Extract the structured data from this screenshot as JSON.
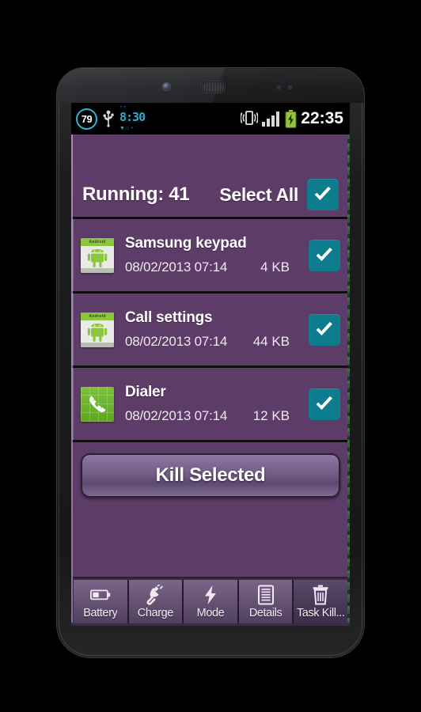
{
  "status_bar": {
    "battery_percent": "79",
    "usb_icon": "usb-icon",
    "clock_widget": {
      "time": "8:30",
      "top_marks": "°°",
      "bottom_marks": "▼○◔"
    },
    "vibrate_icon": "vibrate-icon",
    "signal_icon": "signal-bars-icon",
    "battery_icon": "battery-charging-icon",
    "time": "22:35"
  },
  "header": {
    "running_label": "Running: 41",
    "select_all_label": "Select All",
    "select_all_checked": true
  },
  "list": {
    "rows": [
      {
        "icon": "android-app-icon",
        "icon_badge": "Android",
        "name": "Samsung keypad",
        "date": "08/02/2013 07:14",
        "size": "4 KB",
        "checked": true
      },
      {
        "icon": "android-app-icon",
        "icon_badge": "Android",
        "name": "Call settings",
        "date": "08/02/2013 07:14",
        "size": "44 KB",
        "checked": true
      },
      {
        "icon": "dialer-phone-icon",
        "icon_badge": "",
        "name": "Dialer",
        "date": "08/02/2013 07:14",
        "size": "12 KB",
        "checked": true
      }
    ]
  },
  "action": {
    "kill_label": "Kill Selected"
  },
  "tabbar": {
    "tabs": [
      {
        "label": "Battery",
        "icon": "battery-icon",
        "selected": false
      },
      {
        "label": "Charge",
        "icon": "plug-icon",
        "selected": false
      },
      {
        "label": "Mode",
        "icon": "lightning-icon",
        "selected": false
      },
      {
        "label": "Details",
        "icon": "document-icon",
        "selected": false
      },
      {
        "label": "Task Kill...",
        "icon": "trash-icon",
        "selected": true
      }
    ]
  },
  "colors": {
    "app_background": "#5d3c68",
    "accent_teal": "#0d7c8c",
    "tab_bar": "#3b2c43",
    "status_bar": "#000000",
    "android_green": "#8cc63f"
  }
}
